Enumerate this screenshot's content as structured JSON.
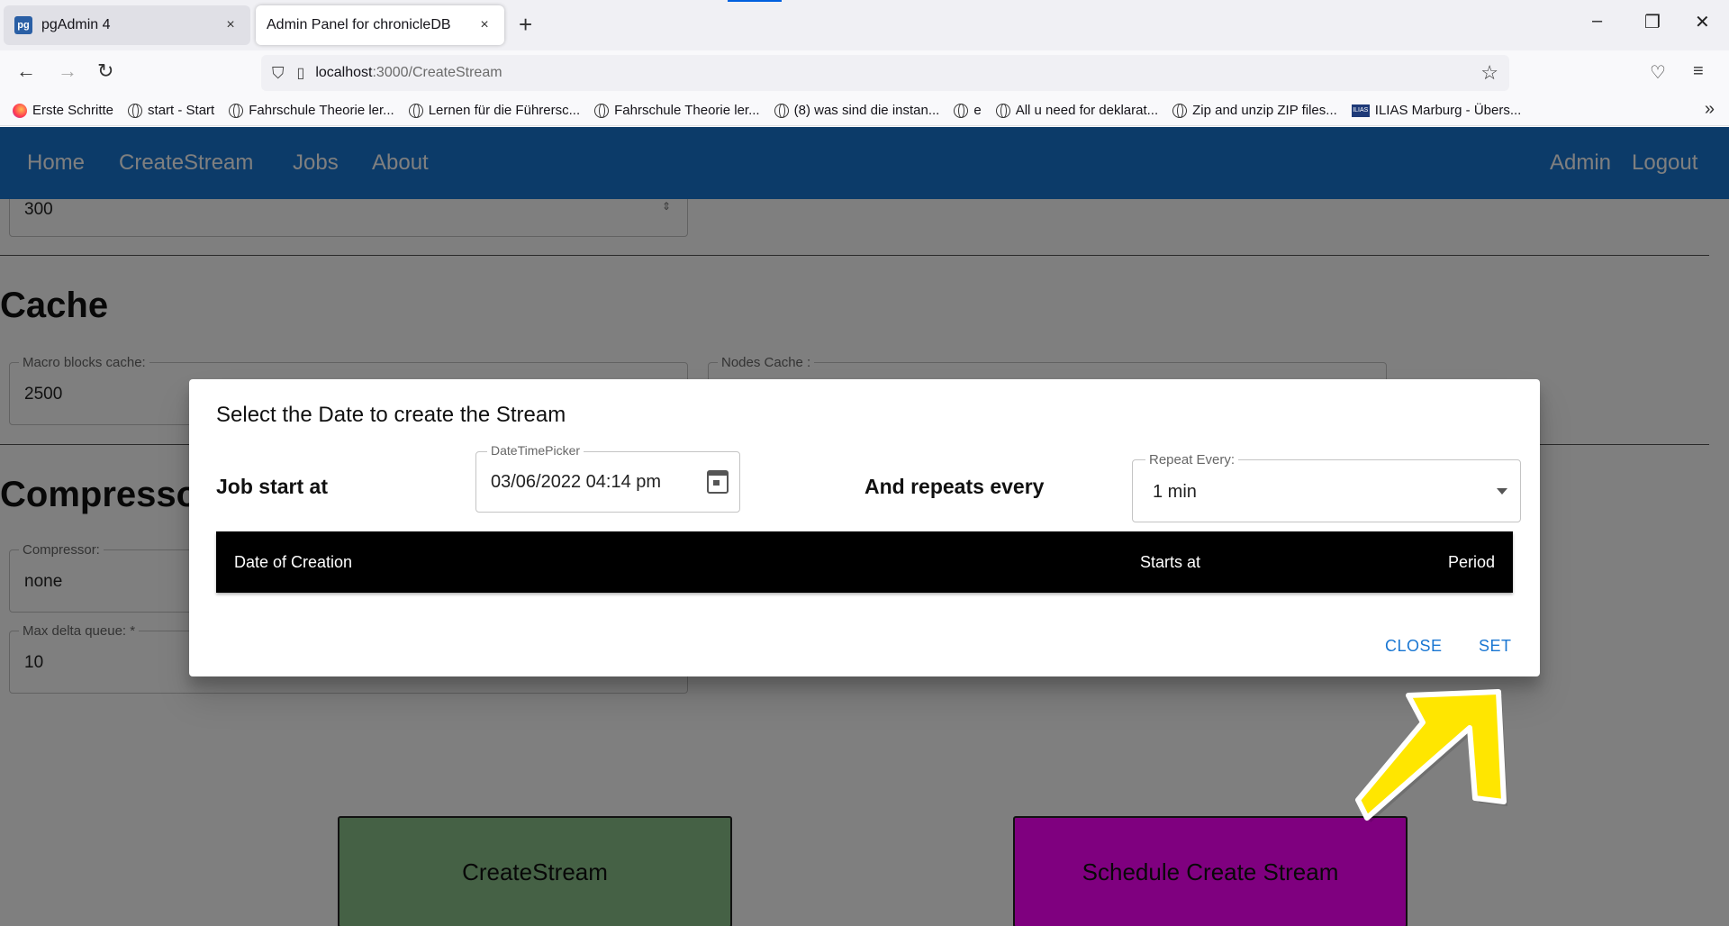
{
  "browser": {
    "tabs": [
      {
        "label": "pgAdmin 4",
        "favicon": "pg",
        "close": "×"
      },
      {
        "label": "Admin Panel for chronicleDB",
        "close": "×"
      }
    ],
    "new_tab": "+",
    "window_controls": {
      "minimize": "–",
      "restore": "❐",
      "close": "✕"
    },
    "nav": {
      "back": "←",
      "forward": "→",
      "reload": "↻"
    },
    "url_host": "localhost",
    "url_path": ":3000/CreateStream",
    "bookmarks": [
      "Erste Schritte",
      "start - Start",
      "Fahrschule Theorie ler...",
      "Lernen für die Führersc...",
      "Fahrschule Theorie ler...",
      "(8) was sind die instan...",
      "e",
      "All u need for deklarat...",
      "Zip and unzip ZIP files...",
      "ILIAS Marburg - Übers..."
    ],
    "ilias_badge": "ILIAS",
    "bookmarks_more": "»"
  },
  "appbar": {
    "nav": [
      "Home",
      "CreateStream",
      "Jobs",
      "About"
    ],
    "right": [
      "Admin",
      "Logout"
    ],
    "color": "#1976d2"
  },
  "form": {
    "top_value": "300",
    "cache_heading": "Cache",
    "macro_label": "Macro blocks cache:",
    "macro_value": "2500",
    "nodes_label": "Nodes Cache :",
    "compressor_heading": "Compressor",
    "compressor_label": "Compressor:",
    "compressor_value": "none",
    "max_delta_label": "Max delta queue: *",
    "max_delta_value": "10",
    "create_button": "CreateStream",
    "schedule_button": "Schedule Create Stream"
  },
  "dialog": {
    "title": "Select the Date to create the Stream",
    "job_start_label": "Job start at",
    "picker_label": "DateTimePicker",
    "picker_value": "03/06/2022 04:14 pm",
    "repeats_label": "And repeats every",
    "repeat_label": "Repeat Every:",
    "repeat_value": "1 min",
    "table_headers": [
      "Date of Creation",
      "Starts at",
      "Period"
    ],
    "close_button": "CLOSE",
    "set_button": "SET"
  },
  "colors": {
    "create_button_bg": "#8bc38b",
    "schedule_button_bg": "#ff00ff",
    "arrow": "#ffe600"
  }
}
